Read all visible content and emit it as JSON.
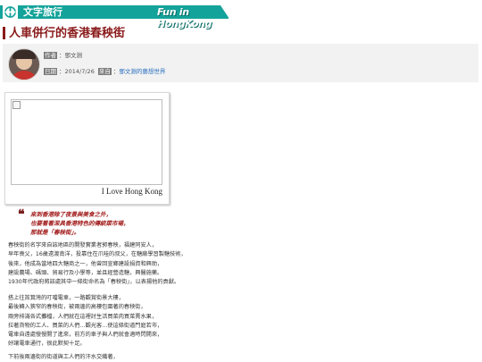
{
  "banner": {
    "title": "文字旅行",
    "subtitle": "Fun in HongKong"
  },
  "article": {
    "title": "人車併行的香港春秧街"
  },
  "meta": {
    "author_tag": "作者",
    "author": "鄧文淵",
    "date_tag": "日期",
    "date": "2014/7/26",
    "from_tag": "來自",
    "blog": "鄧文淵的藝想世界"
  },
  "figure": {
    "caption": "I Love Hong Kong"
  },
  "quote": {
    "lines": [
      "來到香港除了夜景與美食之外，",
      "也要看看深具香港特色的傳統菜市場，",
      "那就是「春秧街」。"
    ]
  },
  "body": {
    "p1": [
      "春秧街的名字來自該地區的開發實業者郭春秧，福建同安人，",
      "早年喪父，16歲遠渡南洋，投靠住在爪哇的叔父，在糖廠學習製糖技術，",
      "後來，他成為當地四大糖商之一，他曾回宣鄉建設捐資和興助，",
      "建設農場、碼頭、貿易行及小學等，並且經營造糖，興醫施藥。",
      "1930年代政府將該處其中一條街命名為「春秧街」，以表揚他的貢獻。"
    ],
    "p2": [
      "搭上往筲箕灣的叮噹電車，一路觀賞街景大樓，",
      "最後轉入狹窄的春秧街，被兩邊的高樓包圍著的春秧街，",
      "兩旁排滿各式攤檔，人們就在這裡討生活買菜肉買菜賣水果，",
      "拉著貨物的工人、買菜的人們…觀光客…使這條街道門庭若市，",
      "電車自遠處慢慢開了進來，前方的車子與人們就會適時閃開來，",
      "好讓電車通行，很此默契十足。"
    ],
    "p3": [
      "下前後兩邊街的街道與工人們的汗水交織著，"
    ]
  }
}
